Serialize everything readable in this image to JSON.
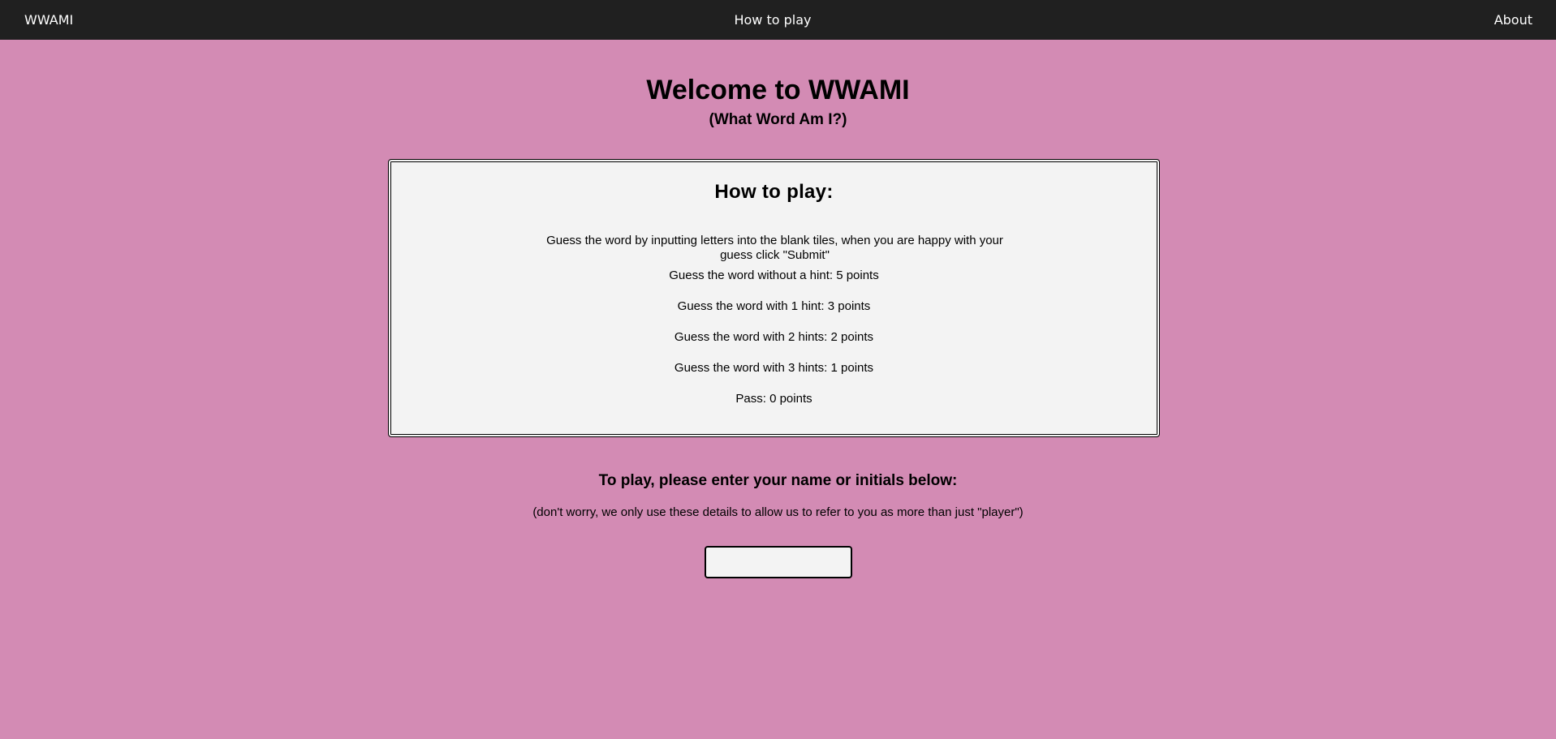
{
  "nav": {
    "brand": "WWAMI",
    "how_to_play": "How to play",
    "about": "About"
  },
  "welcome": {
    "title": "Welcome to WWAMI",
    "subtitle": "(What Word Am I?)"
  },
  "how_to_play": {
    "heading": "How to play:",
    "intro": "Guess the word by inputting letters into the blank tiles, when you are happy with your guess click \"Submit\"",
    "rules": [
      "Guess the word without a hint: 5 points",
      "Guess the word with 1 hint: 3 points",
      "Guess the word with 2 hints: 2 points",
      "Guess the word with 3 hints: 1 points",
      "Pass: 0 points"
    ]
  },
  "player_entry": {
    "heading": "To play, please enter your name or initials below:",
    "note": "(don't worry, we only use these details to allow us to refer to you as more than just \"player\")",
    "name_value": ""
  },
  "colors": {
    "background": "#d38bb4",
    "navbar": "#202020",
    "panel": "#f3f3f3"
  }
}
